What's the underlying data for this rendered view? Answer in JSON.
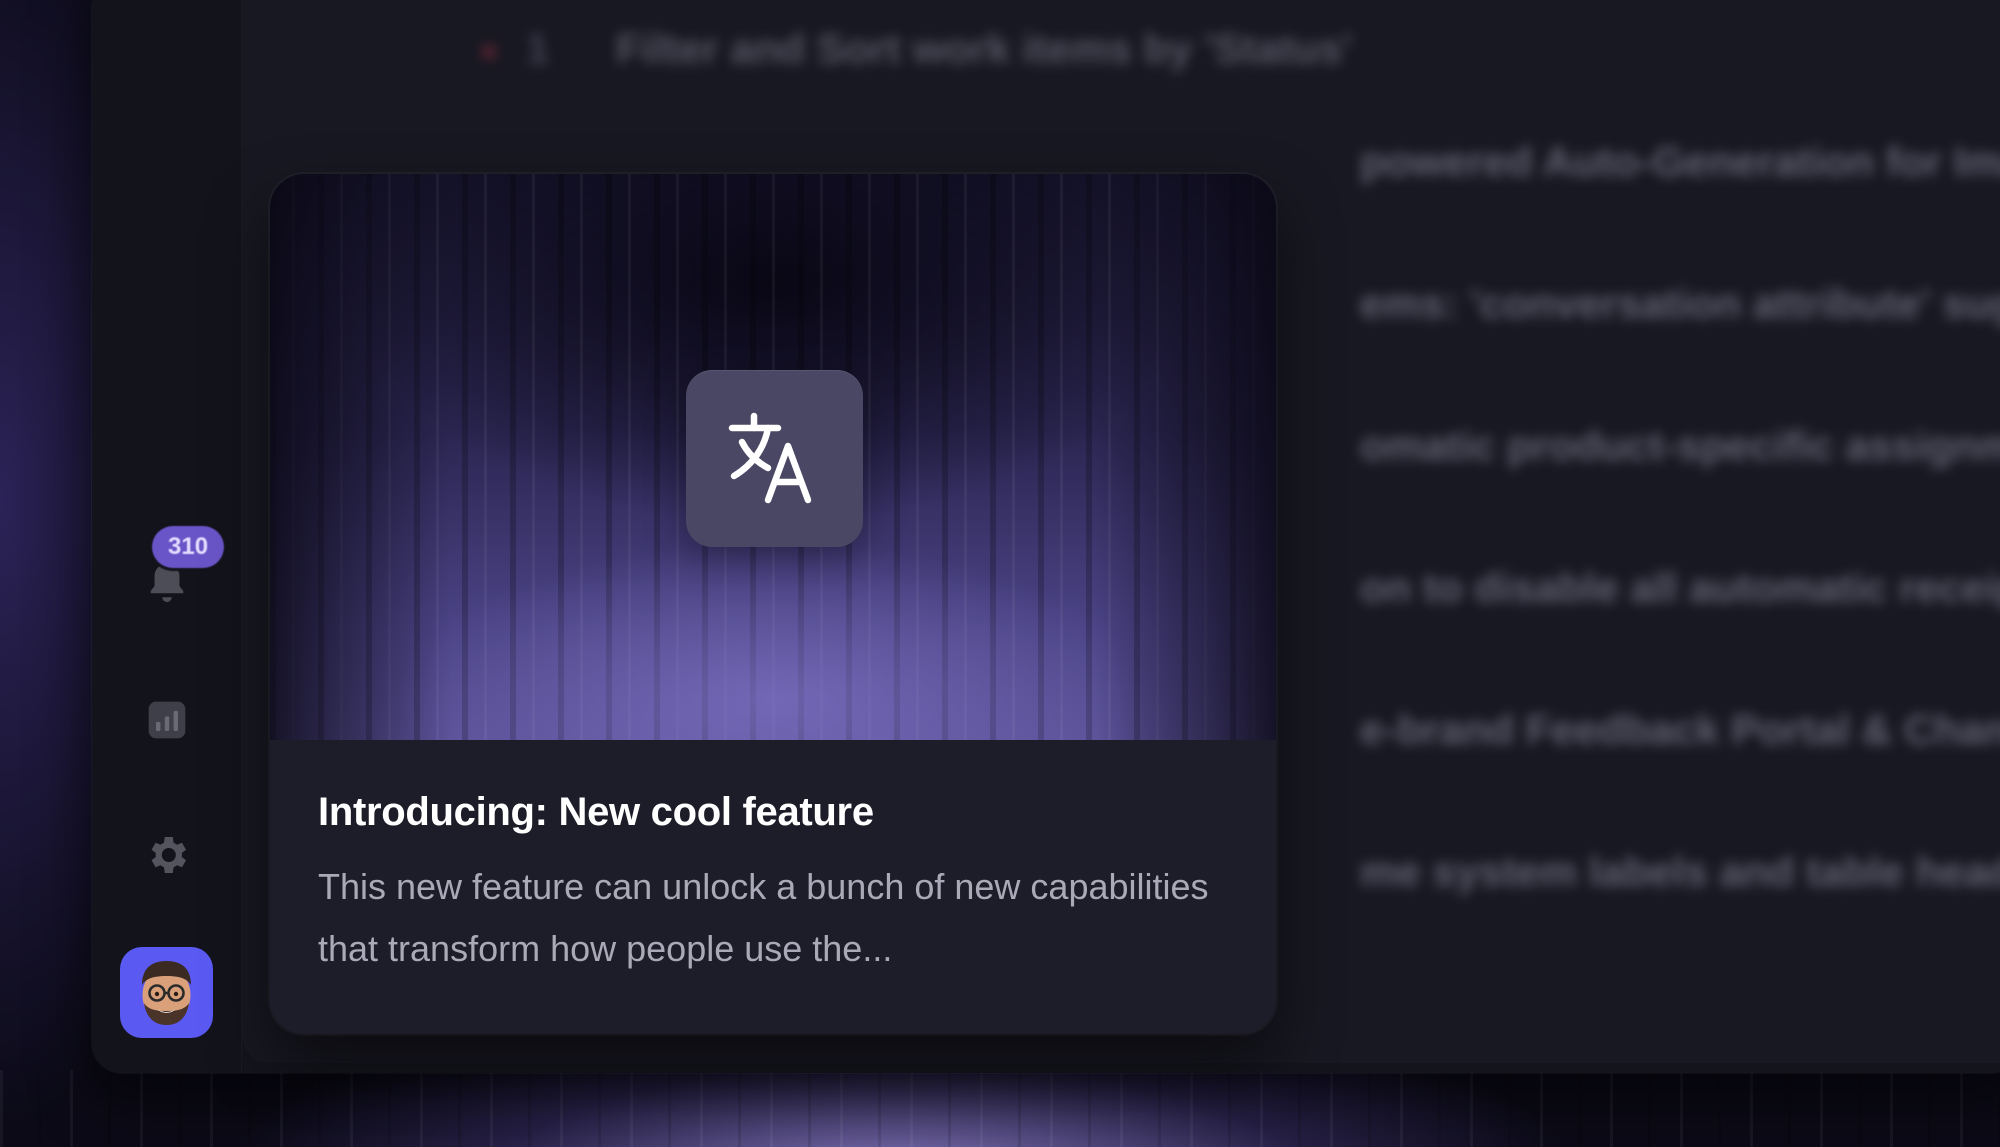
{
  "notifications": {
    "count": "310"
  },
  "sidebar": {
    "icons": [
      "bell-icon",
      "analytics-icon",
      "gear-icon"
    ],
    "avatar": "user-avatar"
  },
  "background_list": {
    "header": "Filter and Sort work items by 'Status'",
    "rows": [
      "powered Auto-Generation for Image",
      "ems: 'conversation attribute' sugg",
      "omatic product-specific assignme",
      "on to disable all automatic receipt",
      "e-brand Feedback Portal & Change",
      "me system labels and table head"
    ]
  },
  "feature_card": {
    "icon": "translate-icon",
    "title": "Introducing: New cool feature",
    "description": "This new feature can unlock a bunch of new capabilities that transform how people use the..."
  },
  "colors": {
    "accent": "#6a55c8",
    "avatar_bg": "#5a59f2",
    "card_bg": "#1d1d29",
    "window_bg": "#14141d"
  }
}
